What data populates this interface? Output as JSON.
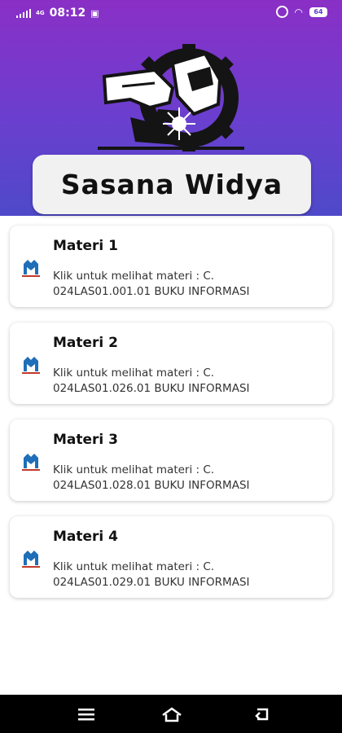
{
  "status_bar": {
    "network": "4G",
    "time": "08:12",
    "battery": "64"
  },
  "header": {
    "app_title": "Sasana Widya"
  },
  "materials": [
    {
      "title": "Materi 1",
      "description": "Klik untuk melihat materi : C.\n024LAS01.001.01 BUKU INFORMASI"
    },
    {
      "title": "Materi 2",
      "description": "Klik untuk melihat materi : C.\n024LAS01.026.01 BUKU INFORMASI"
    },
    {
      "title": "Materi 3",
      "description": "Klik untuk melihat materi : C.\n024LAS01.028.01 BUKU INFORMASI"
    },
    {
      "title": "Materi 4",
      "description": "Klik untuk melihat materi : C.\n024LAS01.029.01 BUKU INFORMASI"
    }
  ],
  "nav_bar": {
    "icons": [
      "menu-icon",
      "home-icon",
      "back-icon"
    ]
  },
  "colors": {
    "header_top": "#8a2fc6",
    "header_bottom": "#4e49c9",
    "item_icon": "#1e6fb8"
  }
}
